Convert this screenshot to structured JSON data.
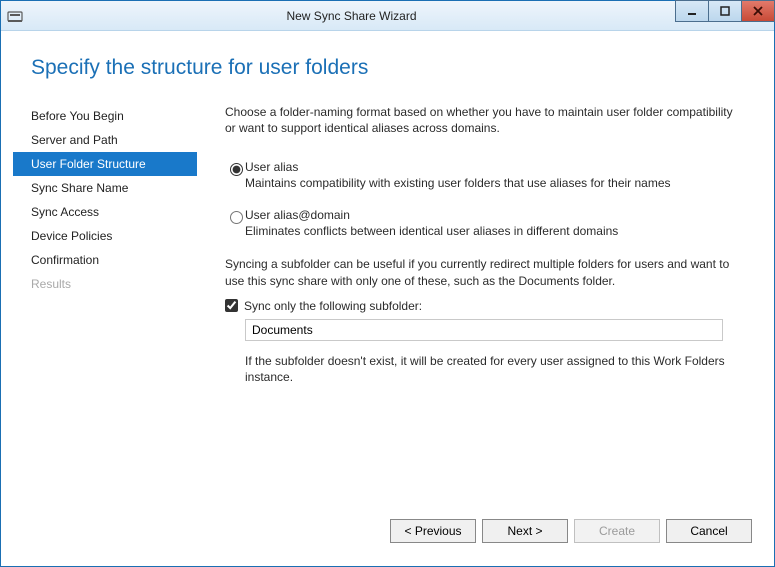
{
  "window": {
    "title": "New Sync Share Wizard"
  },
  "heading": "Specify the structure for user folders",
  "nav": {
    "items": [
      {
        "label": "Before You Begin"
      },
      {
        "label": "Server and Path"
      },
      {
        "label": "User Folder Structure"
      },
      {
        "label": "Sync Share Name"
      },
      {
        "label": "Sync Access"
      },
      {
        "label": "Device Policies"
      },
      {
        "label": "Confirmation"
      },
      {
        "label": "Results"
      }
    ]
  },
  "main": {
    "intro": "Choose a folder-naming format based on whether you have to maintain user folder compatibility or want to support identical aliases across domains.",
    "option1": {
      "title": "User alias",
      "desc": "Maintains compatibility with existing user folders that use aliases for their names"
    },
    "option2": {
      "title": "User alias@domain",
      "desc": "Eliminates conflicts between identical user aliases in different domains"
    },
    "syncDesc": "Syncing a subfolder can be useful if you currently redirect multiple folders for users and want to use this sync share with only one of these, such as the Documents folder.",
    "checkbox": {
      "label": "Sync only the following subfolder:"
    },
    "subfolderValue": "Documents",
    "note": "If the subfolder doesn't exist, it will be created for every user assigned to this Work Folders instance."
  },
  "footer": {
    "previous": "< Previous",
    "next": "Next >",
    "create": "Create",
    "cancel": "Cancel"
  }
}
